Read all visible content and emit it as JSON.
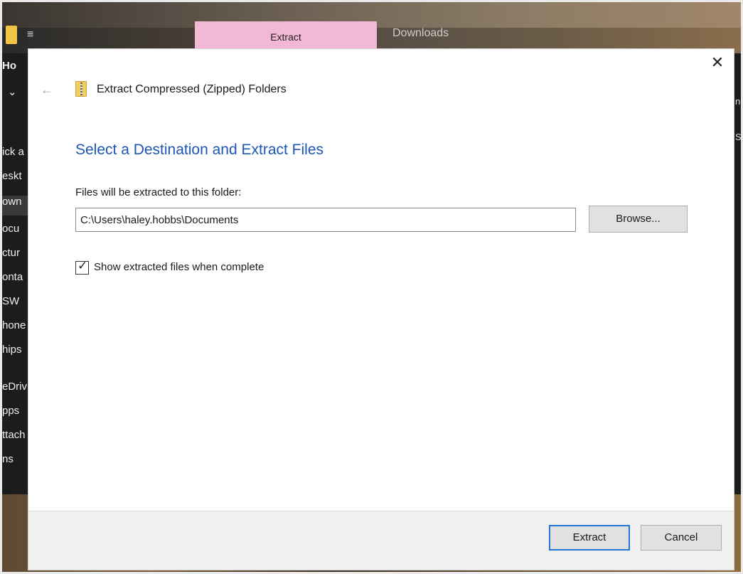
{
  "background": {
    "ribbon_tab_label": "Extract",
    "window_title": "Downloads",
    "ribbon_home_label": "Ho",
    "nav_items": [
      "ick a",
      "eskt",
      "own",
      "ocu",
      "ctur",
      "onta",
      "SW",
      "hone",
      "hips",
      "eDriv",
      "pps",
      "ttach",
      "ns"
    ],
    "right_edge_text": [
      "n",
      "S"
    ]
  },
  "dialog": {
    "title": "Extract Compressed (Zipped) Folders",
    "heading": "Select a Destination and Extract Files",
    "destination_label": "Files will be extracted to this folder:",
    "destination_path": "C:\\Users\\haley.hobbs\\Documents",
    "browse_label": "Browse...",
    "show_files_label": "Show extracted files when complete",
    "show_files_checked": true,
    "extract_label": "Extract",
    "cancel_label": "Cancel",
    "close_glyph": "✕",
    "back_glyph": "←"
  },
  "colors": {
    "heading": "#1c57b3",
    "focus_border": "#1f77d6",
    "tab_highlight": "#f2b8d6"
  },
  "icons": {
    "close": "close-icon",
    "back": "back-arrow-icon",
    "zip_folder": "zip-folder-icon",
    "check": "checkmark-icon"
  }
}
